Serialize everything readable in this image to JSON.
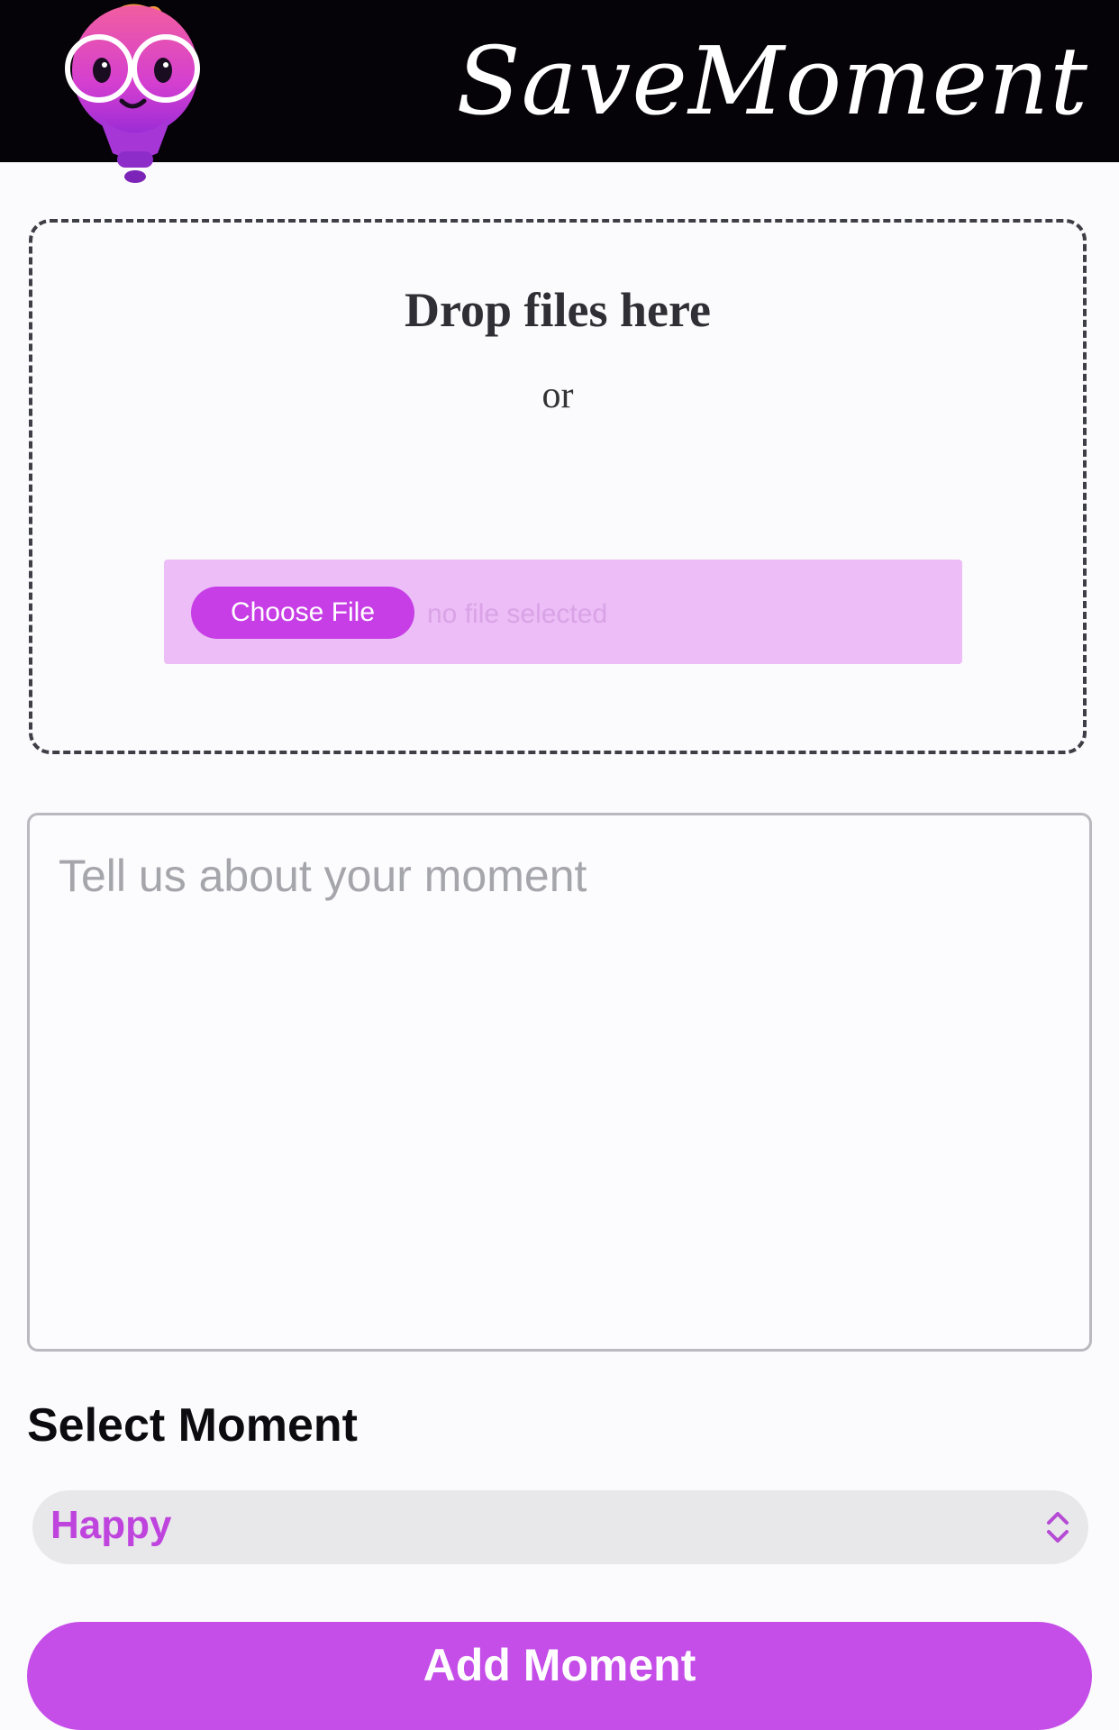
{
  "header": {
    "brand": "SaveMoment",
    "mascot_icon": "mascot-logo-icon"
  },
  "dropzone": {
    "title": "Drop files here",
    "or_text": "or",
    "choose_file_label": "Choose File",
    "no_file_text": "no file selected"
  },
  "moment_text": {
    "placeholder": "Tell us about your moment",
    "value": ""
  },
  "moment_select": {
    "label": "Select Moment",
    "selected": "Happy",
    "chevron_icon": "select-chevron-icon"
  },
  "submit": {
    "label": "Add Moment"
  },
  "colors": {
    "accent": "#c73de6",
    "header_bg": "#050307",
    "file_input_bg": "#ecbdf6",
    "select_text": "#bf44de"
  }
}
